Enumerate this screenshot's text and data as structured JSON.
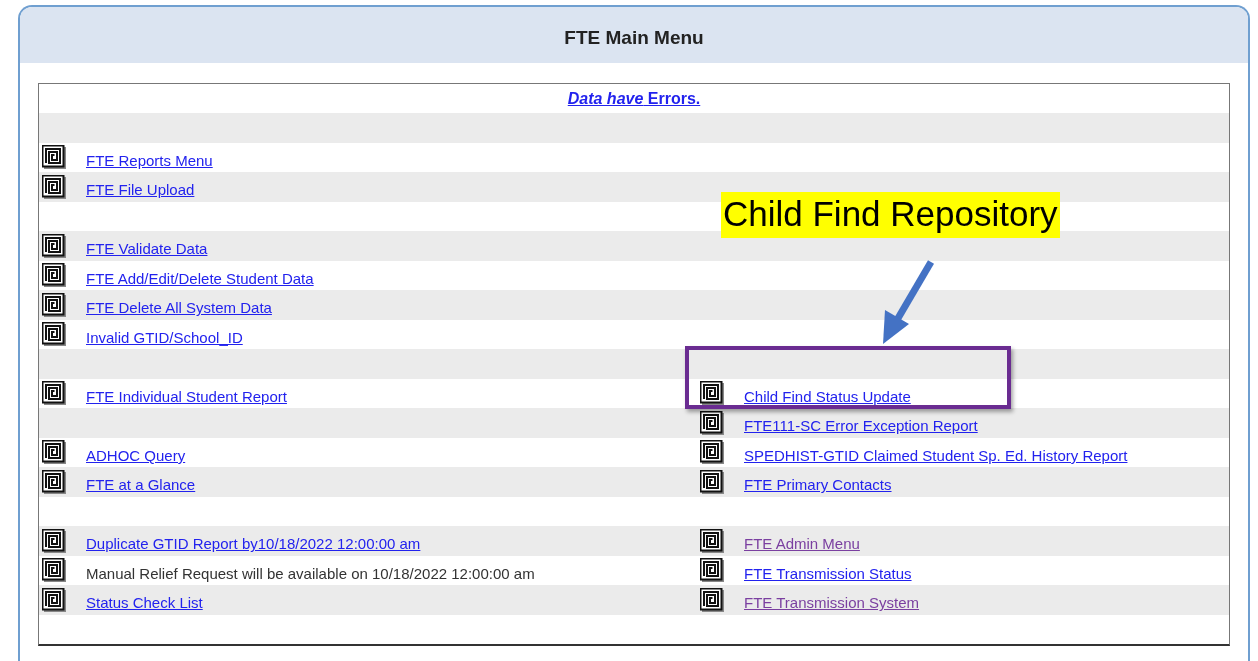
{
  "window": {
    "title": "FTE Main Menu"
  },
  "notice": {
    "text": "*Data have* Errors."
  },
  "rows": [
    {
      "kind": "spacer"
    },
    {
      "kind": "entries",
      "left": {
        "kind": "link",
        "label": "FTE Reports Menu",
        "visited": false
      }
    },
    {
      "kind": "entries",
      "left": {
        "kind": "link",
        "label": "FTE File Upload",
        "visited": false
      }
    },
    {
      "kind": "spacer"
    },
    {
      "kind": "entries",
      "left": {
        "kind": "link",
        "label": "FTE Validate Data",
        "visited": false
      }
    },
    {
      "kind": "entries",
      "left": {
        "kind": "link",
        "label": "FTE Add/Edit/Delete Student Data",
        "visited": false
      }
    },
    {
      "kind": "entries",
      "left": {
        "kind": "link",
        "label": "FTE Delete All System Data",
        "visited": false
      }
    },
    {
      "kind": "entries",
      "left": {
        "kind": "link",
        "label": "Invalid GTID/School_ID",
        "visited": false
      }
    },
    {
      "kind": "spacer"
    },
    {
      "kind": "entries",
      "left": {
        "kind": "link",
        "label": "FTE Individual Student Report",
        "visited": false
      },
      "right": {
        "kind": "link",
        "label": "Child Find Status Update",
        "visited": false,
        "highlighted": true
      }
    },
    {
      "kind": "entries",
      "right": {
        "kind": "link",
        "label": "FTE111-SC Error Exception Report",
        "visited": false
      }
    },
    {
      "kind": "entries",
      "left": {
        "kind": "link",
        "label": "ADHOC Query",
        "visited": false
      },
      "right": {
        "kind": "link",
        "label": "SPEDHIST-GTID Claimed Student Sp. Ed. History Report",
        "visited": false
      }
    },
    {
      "kind": "entries",
      "left": {
        "kind": "link",
        "label": "FTE at a Glance",
        "visited": false
      },
      "right": {
        "kind": "link",
        "label": "FTE Primary Contacts",
        "visited": false
      }
    },
    {
      "kind": "spacer"
    },
    {
      "kind": "entries",
      "left": {
        "kind": "link",
        "label": "Duplicate GTID Report by10/18/2022 12:00:00 am",
        "visited": false
      },
      "right": {
        "kind": "link",
        "label": "FTE Admin Menu",
        "visited": true
      }
    },
    {
      "kind": "entries",
      "left": {
        "kind": "text",
        "label": "Manual Relief Request will be available on 10/18/2022 12:00:00 am"
      },
      "right": {
        "kind": "link",
        "label": "FTE Transmission Status",
        "visited": false
      }
    },
    {
      "kind": "entries",
      "left": {
        "kind": "link",
        "label": "Status Check List",
        "visited": false
      },
      "right": {
        "kind": "link",
        "label": "FTE Transmission System",
        "visited": true
      }
    },
    {
      "kind": "spacer"
    }
  ],
  "annotation": {
    "callout": "Child Find Repository"
  }
}
